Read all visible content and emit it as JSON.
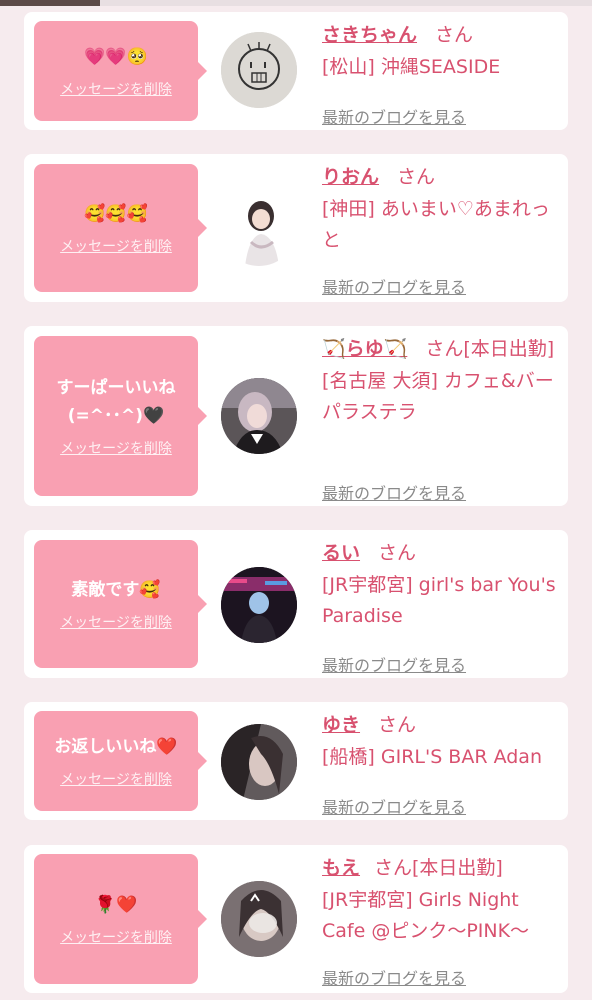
{
  "delete_label": "メッセージを削除",
  "blog_label": "最新のブログを見る",
  "entries": [
    {
      "message": "💗💗🥺",
      "name": "さきちゃん",
      "suffix": "さん",
      "shop": "[松山] 沖縄SEASIDE"
    },
    {
      "message": "🥰🥰🥰",
      "name": "りおん",
      "suffix": "さん",
      "shop": "[神田] あいまい♡あまれっと"
    },
    {
      "message": "すーぱーいいね(=^･･^)🖤",
      "name": "🏹らゆ🏹",
      "suffix": "さん[本日出勤]",
      "shop": "[名古屋 大須] カフェ&バー パラステラ"
    },
    {
      "message": "素敵です🥰",
      "name": "るい",
      "suffix": "さん",
      "shop": "[JR宇都宮] girl's bar You's Paradise"
    },
    {
      "message": "お返しいいね❤️",
      "name": "ゆき",
      "suffix": "さん",
      "shop": "[船橋] GIRL'S BAR Adan"
    },
    {
      "message": "🌹❤️",
      "name": "もえ",
      "suffix": "さん[本日出勤]",
      "shop": "[JR宇都宮] Girls Night Cafe @ピンク〜PINK〜"
    }
  ],
  "colors": {
    "accent": "#d8516f",
    "bubble": "#f9a0b2",
    "background": "#f6ebee"
  }
}
